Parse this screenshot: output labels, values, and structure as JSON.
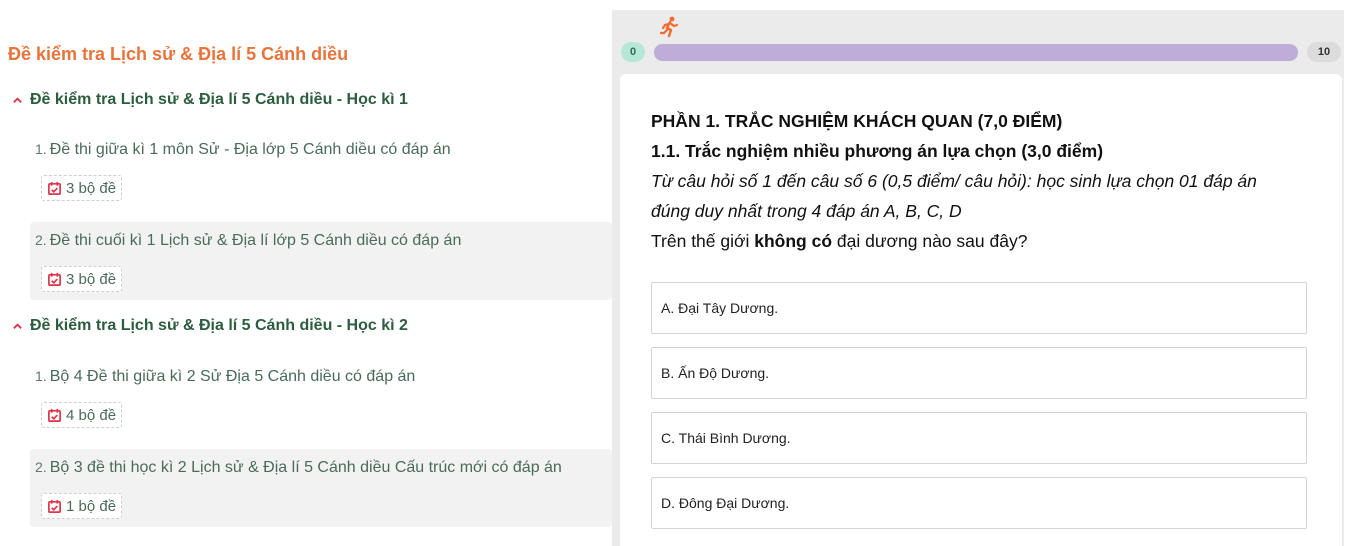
{
  "left": {
    "title": "Đề kiểm tra Lịch sử & Địa lí 5 Cánh diều",
    "sections": [
      {
        "title": "Đề kiểm tra Lịch sử & Địa lí 5 Cánh diều - Học kì 1",
        "items": [
          {
            "num": "1.",
            "title": "Đề thi giữa kì 1 môn Sử - Địa lớp 5 Cánh diều có đáp án",
            "badge": "3 bộ đề"
          },
          {
            "num": "2.",
            "title": "Đề thi cuối kì 1 Lịch sử & Địa lí lớp 5 Cánh diều có đáp án",
            "badge": "3 bộ đề"
          }
        ]
      },
      {
        "title": "Đề kiểm tra Lịch sử & Địa lí 5 Cánh diều - Học kì 2",
        "items": [
          {
            "num": "1.",
            "title": "Bộ 4 Đề thi giữa kì 2 Sử Địa 5 Cánh diều có đáp án",
            "badge": "4 bộ đề"
          },
          {
            "num": "2.",
            "title": "Bộ 3 đề thi học kì 2 Lịch sử & Địa lí 5 Cánh diều Cấu trúc mới có đáp án",
            "badge": "1 bộ đề"
          }
        ]
      }
    ]
  },
  "quiz": {
    "progress": {
      "start": "0",
      "end": "10",
      "fraction": 0.0
    },
    "part_heading": "PHẦN 1. TRẮC NGHIỆM KHÁCH QUAN (7,0 ĐIỂM)",
    "sub_heading": "1.1. Trắc nghiệm nhiều phương án lựa chọn (3,0 điểm)",
    "instruction_1": "Từ câu hỏi số 1 đến câu số 6 (0,5 điểm/ câu hỏi): học sinh lựa chọn 01 đáp án",
    "instruction_2": "đúng duy nhất trong 4 đáp án A, B, C, D",
    "question_pre": "Trên thế giới ",
    "question_bold": "không có",
    "question_post": " đại dương nào sau đây?",
    "options": [
      "A. Đại Tây Dương.",
      "B. Ấn Độ Dương.",
      "C. Thái Bình Dương.",
      "D. Đông Đại Dương."
    ]
  },
  "colors": {
    "title_orange": "#e8743b",
    "section_green": "#2d5d3f",
    "badge_icon_red": "#e0344a",
    "progress_purple": "#bfadd9",
    "runner_orange": "#f26a2e"
  },
  "icons": {
    "section_toggle": "chevron-up-icon",
    "badge": "calendar-check-icon",
    "runner": "running-person-icon"
  }
}
